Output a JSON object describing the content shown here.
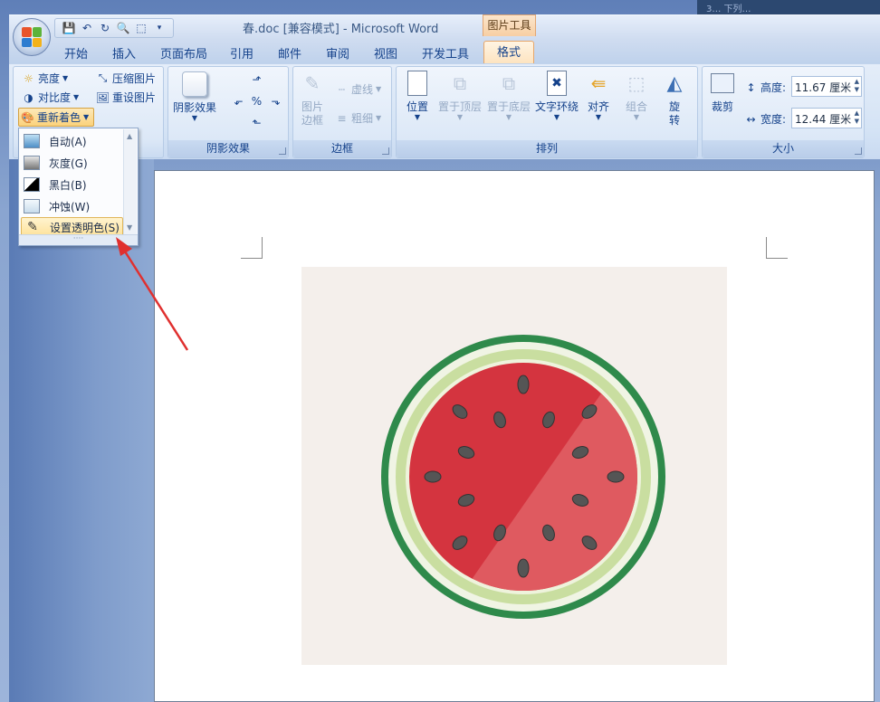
{
  "window": {
    "title": "春.doc [兼容模式] - Microsoft Word",
    "desktop_label": "3… 下列…"
  },
  "contextual_tab_group": "图片工具",
  "tabs": [
    "开始",
    "插入",
    "页面布局",
    "引用",
    "邮件",
    "审阅",
    "视图",
    "开发工具"
  ],
  "active_tab": "格式",
  "adjust": {
    "brightness": "亮度",
    "contrast": "对比度",
    "recolor": "重新着色",
    "compress": "压缩图片",
    "reset": "重设图片"
  },
  "recolor_menu": {
    "items": [
      {
        "label": "自动(A)",
        "name": "recolor-auto"
      },
      {
        "label": "灰度(G)",
        "name": "recolor-grayscale"
      },
      {
        "label": "黑白(B)",
        "name": "recolor-black-white"
      },
      {
        "label": "冲蚀(W)",
        "name": "recolor-washout"
      },
      {
        "label": "设置透明色(S)",
        "name": "set-transparent-color"
      }
    ]
  },
  "shadow_group": {
    "label": "阴影效果",
    "button": "阴影效果"
  },
  "border_group": {
    "label": "边框",
    "picture_border": "图片\n边框",
    "dashes": "虚线",
    "weight": "粗细"
  },
  "arrange_group": {
    "label": "排列",
    "position": "位置",
    "bring_front": "置于顶层",
    "send_back": "置于底层",
    "text_wrap": "文字环绕",
    "align": "对齐",
    "group": "组合",
    "rotate": "旋\n转"
  },
  "size_group": {
    "label": "大小",
    "crop": "裁剪",
    "height_label": "高度:",
    "height_value": "11.67 厘米",
    "width_label": "宽度:",
    "width_value": "12.44 厘米"
  },
  "colors": {
    "accent": "#15428b",
    "highlight": "#fde29a",
    "arrow": "#e0302f",
    "rind": "#2f8a4b",
    "flesh": "#d4343f"
  }
}
